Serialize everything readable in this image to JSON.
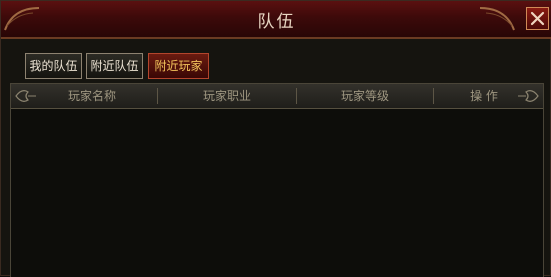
{
  "window": {
    "title": "队伍",
    "close_icon": "close-x-icon"
  },
  "tabs": [
    {
      "label": "我的队伍",
      "active": false
    },
    {
      "label": "附近队伍",
      "active": false
    },
    {
      "label": "附近玩家",
      "active": true
    }
  ],
  "table": {
    "columns": [
      "玩家名称",
      "玩家职业",
      "玩家等级",
      "操 作"
    ],
    "rows": []
  },
  "colors": {
    "title_bar": "#4a0c0c",
    "active_tab_text": "#f3c45c",
    "header_text": "#9e9680"
  }
}
